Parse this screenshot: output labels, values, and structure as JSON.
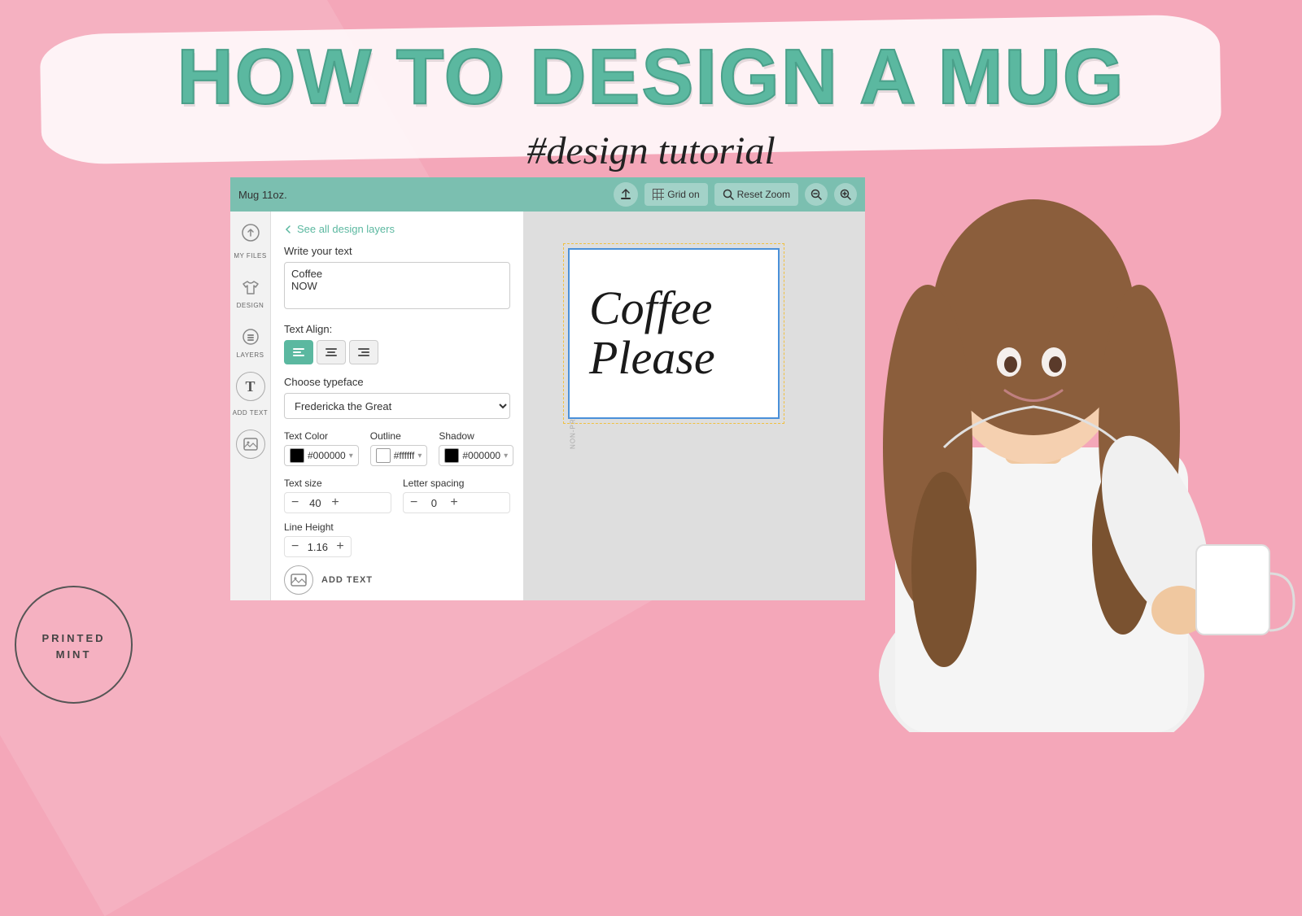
{
  "background": {
    "color": "#f4a7b9"
  },
  "title": {
    "main": "HOW TO DESIGN A MUG",
    "subtitle": "#design tutorial"
  },
  "toolbar": {
    "product_label": "Mug 11oz.",
    "grid_btn": "Grid on",
    "reset_zoom_btn": "Reset Zoom",
    "zoom_in_icon": "zoom-in-icon",
    "zoom_out_icon": "zoom-out-icon"
  },
  "editor": {
    "back_link": "See all design layers",
    "write_text_label": "Write your text",
    "text_content": "Coffee\nNOW",
    "text_align_label": "Text Align:",
    "align_options": [
      "left",
      "center",
      "right"
    ],
    "active_align": "left",
    "typeface_label": "Choose typeface",
    "typeface_value": "Fredericka the Great",
    "text_color_label": "Text Color",
    "text_color_value": "#000000",
    "outline_label": "Outline",
    "outline_color_value": "#ffffff",
    "shadow_label": "Shadow",
    "shadow_color_value": "#000000",
    "text_size_label": "Text size",
    "text_size_value": "40",
    "letter_spacing_label": "Letter spacing",
    "letter_spacing_value": "0",
    "line_height_label": "Line Height",
    "line_height_value": "1.16",
    "add_text_label": "ADD TEXT"
  },
  "canvas": {
    "text_line1": "Coffee",
    "text_line2": "Please"
  },
  "sidebar": {
    "upload_icon": "upload-icon",
    "my_files_label": "MY FILES",
    "tshirt_icon": "tshirt-icon",
    "design_label": "DESIGN",
    "layers_icon": "layers-icon",
    "layers_label": "LAYERS",
    "text_icon": "text-icon",
    "add_text_label": "ADD TEXT",
    "image_icon": "image-icon"
  },
  "logo": {
    "line1": "PRINTED",
    "line2": "MINT"
  }
}
